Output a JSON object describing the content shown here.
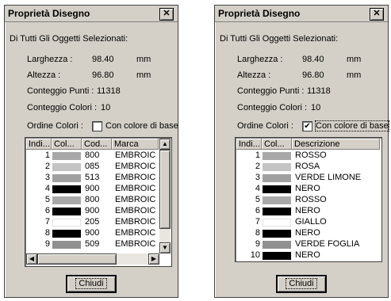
{
  "left_dialog": {
    "title": "Proprietà Disegno",
    "close_glyph": "✕",
    "selected_caption": "Di Tutti Gli Oggetti Selezionati:",
    "width_label": "Larghezza :",
    "width_value": "98.40",
    "width_unit": "mm",
    "height_label": "Altezza :",
    "height_value": "96.80",
    "height_unit": "mm",
    "points_label": "Conteggio Punti :",
    "points_value": "11318",
    "colors_label": "Conteggio Colori :",
    "colors_value": "10",
    "order_label": "Ordine Colori :",
    "checkbox_label": "Con colore di base",
    "checkbox_checked": false,
    "columns": [
      "Indi...",
      "Col...",
      "Cod...",
      "Marca"
    ],
    "rows": [
      {
        "idx": "1",
        "color": "#a8a8a8",
        "code": "800",
        "brand": "EMBROIC"
      },
      {
        "idx": "2",
        "color": "#c4c4c4",
        "code": "085",
        "brand": "EMBROIC"
      },
      {
        "idx": "3",
        "color": "#a0a0a0",
        "code": "513",
        "brand": "EMBROIC"
      },
      {
        "idx": "4",
        "color": "#000000",
        "code": "900",
        "brand": "EMBROIC"
      },
      {
        "idx": "5",
        "color": "#a8a8a8",
        "code": "800",
        "brand": "EMBROIC"
      },
      {
        "idx": "6",
        "color": "#000000",
        "code": "900",
        "brand": "EMBROIC"
      },
      {
        "idx": "7",
        "color": "#ffffff",
        "code": "205",
        "brand": "EMBROIC"
      },
      {
        "idx": "8",
        "color": "#000000",
        "code": "900",
        "brand": "EMBROIC"
      },
      {
        "idx": "9",
        "color": "#909090",
        "code": "509",
        "brand": "EMBROIC"
      }
    ],
    "button_label": "Chiudi"
  },
  "right_dialog": {
    "title": "Proprietà Disegno",
    "close_glyph": "✕",
    "selected_caption": "Di Tutti Gli Oggetti Selezionati:",
    "width_label": "Larghezza :",
    "width_value": "98.40",
    "width_unit": "mm",
    "height_label": "Altezza :",
    "height_value": "96.80",
    "height_unit": "mm",
    "points_label": "Conteggio Punti :",
    "points_value": "11318",
    "colors_label": "Conteggio Colori :",
    "colors_value": "10",
    "order_label": "Ordine Colori :",
    "checkbox_label": "Con colore di base",
    "checkbox_checked": true,
    "check_glyph": "✔",
    "columns": [
      "Indi...",
      "Col...",
      "Descrizione"
    ],
    "rows": [
      {
        "idx": "1",
        "color": "#a8a8a8",
        "desc": "ROSSO"
      },
      {
        "idx": "2",
        "color": "#c4c4c4",
        "desc": "ROSA"
      },
      {
        "idx": "3",
        "color": "#a0a0a0",
        "desc": "VERDE LIMONE"
      },
      {
        "idx": "4",
        "color": "#000000",
        "desc": "NERO"
      },
      {
        "idx": "5",
        "color": "#a8a8a8",
        "desc": "ROSSO"
      },
      {
        "idx": "6",
        "color": "#000000",
        "desc": "NERO"
      },
      {
        "idx": "7",
        "color": "#ffffff",
        "desc": "GIALLO"
      },
      {
        "idx": "8",
        "color": "#000000",
        "desc": "NERO"
      },
      {
        "idx": "9",
        "color": "#909090",
        "desc": "VERDE FOGLIA"
      },
      {
        "idx": "10",
        "color": "#000000",
        "desc": "NERO"
      }
    ],
    "button_label": "Chiudi"
  },
  "scroll_glyphs": {
    "up": "▲",
    "down": "▼",
    "left": "◀",
    "right": "▶"
  }
}
